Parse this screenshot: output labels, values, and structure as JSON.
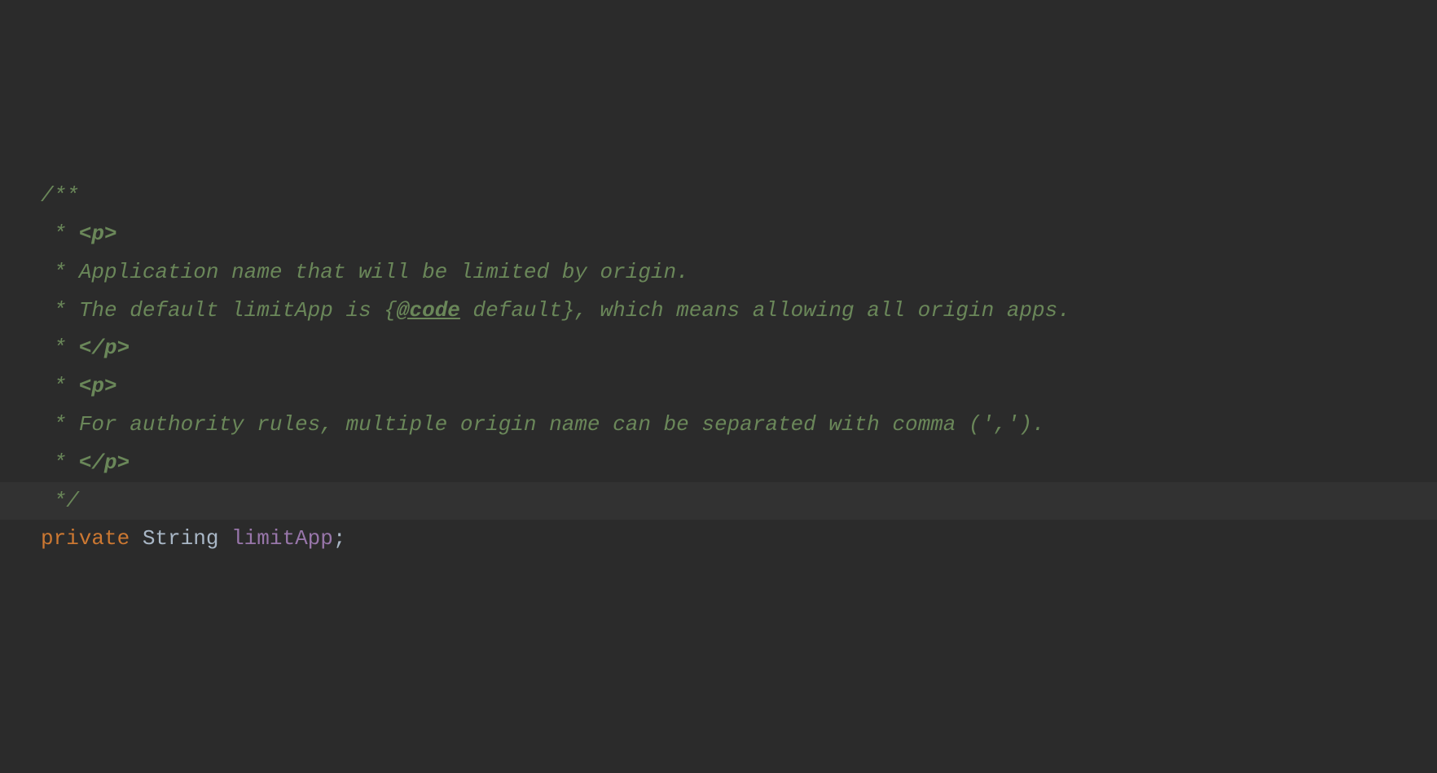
{
  "code": {
    "line1": {
      "open": "/**"
    },
    "line2": {
      "star": " * ",
      "tag": "<p>"
    },
    "line3": {
      "star": " * ",
      "text": "Application name that will be limited by origin."
    },
    "line4": {
      "star": " * ",
      "text1": "The default limitApp is {",
      "tag": "@code",
      "text2": " default}, which means allowing all origin apps."
    },
    "line5": {
      "star": " * ",
      "tag": "</p>"
    },
    "line6": {
      "star": " * ",
      "tag": "<p>"
    },
    "line7": {
      "star": " * ",
      "text": "For authority rules, multiple origin name can be separated with comma (',')."
    },
    "line8": {
      "star": " * ",
      "tag": "</p>"
    },
    "line9": {
      "close": " */"
    },
    "line10": {
      "keyword": "private",
      "space1": " ",
      "type": "String",
      "space2": " ",
      "field": "limitApp",
      "semi": ";"
    }
  }
}
